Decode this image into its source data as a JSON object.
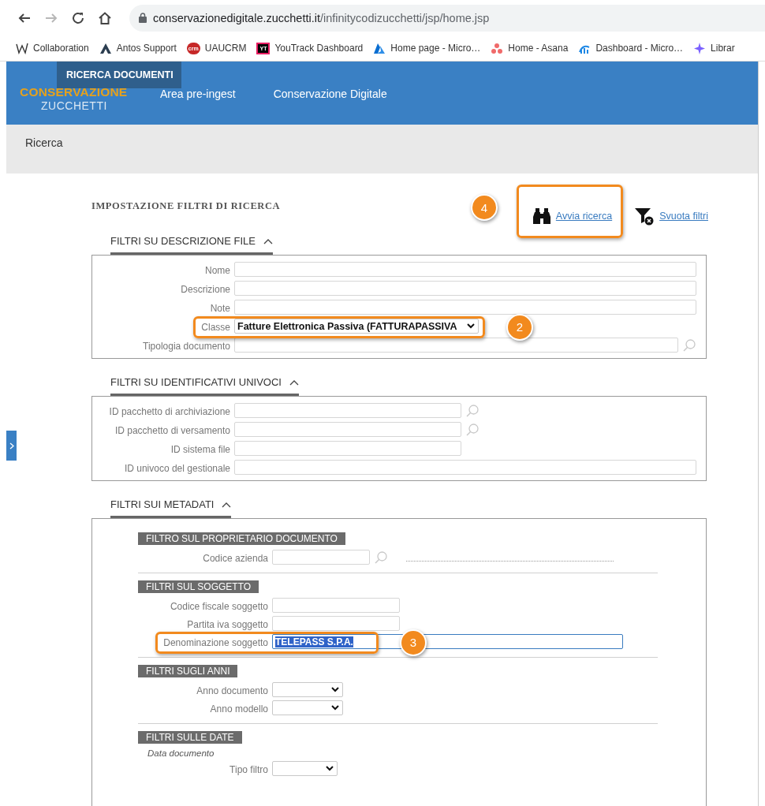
{
  "browser": {
    "nav_buttons": [
      {
        "kind": "back",
        "disabled": false
      },
      {
        "kind": "forward",
        "disabled": true
      },
      {
        "kind": "reload",
        "disabled": false
      },
      {
        "kind": "home",
        "disabled": false
      }
    ],
    "url": {
      "host": "conservazionedigitale.zucchetti.it",
      "path": "/infinitycodizucchetti/jsp/home.jsp"
    }
  },
  "bookmarks": [
    {
      "label": "Collaboration",
      "kind": "wave"
    },
    {
      "label": "Antos Support",
      "kind": "peak"
    },
    {
      "label": "UAUCRM",
      "kind": "crm",
      "icon_text": "crm"
    },
    {
      "label": "YouTrack Dashboard",
      "kind": "yt",
      "icon_text": "YT"
    },
    {
      "label": "Home page - Micro…",
      "kind": "azure"
    },
    {
      "label": "Home - Asana",
      "kind": "dots"
    },
    {
      "label": "Dashboard - Micro…",
      "kind": "swirl"
    },
    {
      "label": "Librar",
      "kind": "star"
    }
  ],
  "app_header": {
    "logo": {
      "top": "CONSERVAZIONE",
      "bottom": "ZUCCHETTI"
    },
    "tag": "RICERCA DOCUMENTI",
    "nav": [
      "Area pre-ingest",
      "Conservazione Digitale"
    ]
  },
  "page_title": "Ricerca",
  "filters": {
    "title": "IMPOSTAZIONE FILTRI DI RICERCA",
    "actions": [
      {
        "kind": "search",
        "label": "Avvia ricerca",
        "callout": "4"
      },
      {
        "kind": "clear",
        "label": "Svuota filtri"
      }
    ],
    "sections": [
      {
        "title": "FILTRI SU DESCRIZIONE FILE",
        "expanded": true,
        "fields": [
          {
            "label": "Nome",
            "kind": "text"
          },
          {
            "label": "Descrizione",
            "kind": "text"
          },
          {
            "label": "Note",
            "kind": "text"
          },
          {
            "label": "Classe",
            "kind": "select",
            "value": "Fatture Elettronica Passiva (FATTURAPASSIVA",
            "callout": "2"
          },
          {
            "label": "Tipologia documento",
            "kind": "lookup"
          }
        ]
      },
      {
        "title": "FILTRI SU IDENTIFICATIVI UNIVOCI",
        "expanded": true,
        "fields": [
          {
            "label": "ID pacchetto di archiviazione",
            "kind": "lookup"
          },
          {
            "label": "ID pacchetto di versamento",
            "kind": "lookup"
          },
          {
            "label": "ID sistema file",
            "kind": "text"
          },
          {
            "label": "ID univoco del gestionale",
            "kind": "text"
          }
        ]
      },
      {
        "title": "FILTRI SUI METADATI",
        "expanded": true,
        "groups": [
          {
            "title": "FILTRO SUL PROPRIETARIO DOCUMENTO",
            "fields": [
              {
                "label": "Codice azienda",
                "kind": "lookup",
                "dotted_description": true
              }
            ]
          },
          {
            "title": "FILTRI SUL SOGGETTO",
            "fields": [
              {
                "label": "Codice fiscale soggetto",
                "kind": "text"
              },
              {
                "label": "Partita iva soggetto",
                "kind": "text"
              },
              {
                "label": "Denominazione soggetto",
                "kind": "text",
                "value": "TELEPASS S.P.A.",
                "value_selected": true,
                "focused": true,
                "callout": "3"
              }
            ]
          },
          {
            "title": "FILTRI SUGLI ANNI",
            "fields": [
              {
                "label": "Anno documento",
                "kind": "select"
              },
              {
                "label": "Anno modello",
                "kind": "select"
              }
            ]
          },
          {
            "title": "FILTRI SULLE DATE",
            "fields": [
              {
                "label": "Data documento",
                "kind": "caption"
              },
              {
                "label": "Tipo filtro",
                "kind": "select"
              }
            ]
          }
        ]
      }
    ]
  }
}
